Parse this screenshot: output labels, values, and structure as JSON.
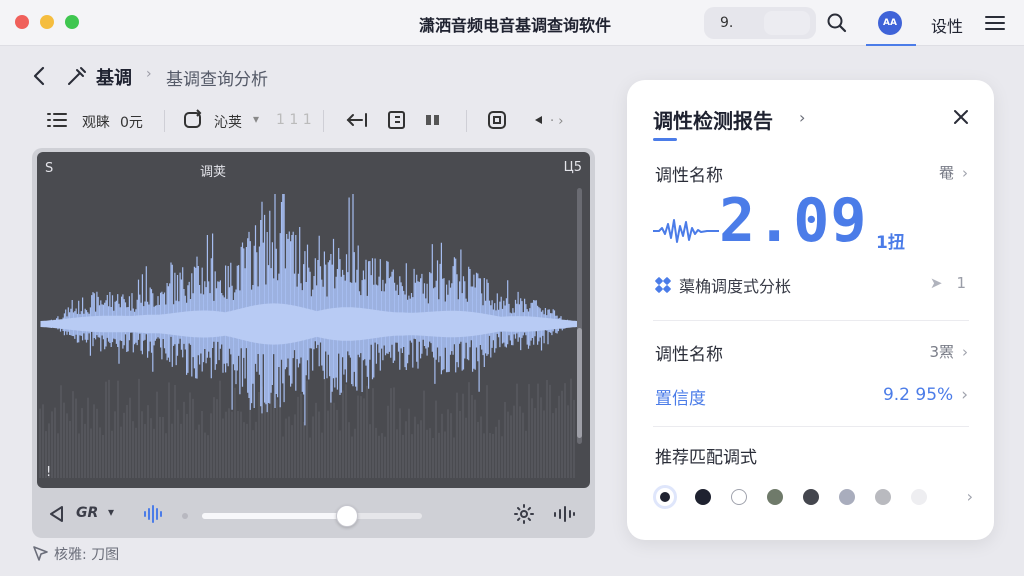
{
  "window": {
    "title": "潇洒音频电音基调查询软件",
    "search_value": "9.",
    "avatar_text": "AA",
    "settings_label": "设性"
  },
  "breadcrumb": {
    "main": "基调",
    "separator": "›",
    "sub": "基调查询分析"
  },
  "toolbar": {
    "list_label": "观睐",
    "count_label": "0元",
    "mode_label": "沁荚",
    "mode_dropdown": "▾",
    "faint_label": "1 1 1"
  },
  "waveform": {
    "corner_left": "S",
    "center_label": "调荚",
    "corner_right": "Ц5",
    "corner_bottom_left": "!",
    "transport_label": "GR",
    "transport_dropdown": "▾",
    "slider_progress": 0.66
  },
  "footnote": "核雅: 刀图",
  "report": {
    "title": "调性检测报告",
    "title_chevron": "›",
    "row1_label": "调性名称",
    "row1_value": "罨",
    "big_value": "2.09",
    "big_unit": "1扭",
    "analysis_text": "蕖桷调度式分枨",
    "analysis_value": "1",
    "row2_label": "调性名称",
    "row2_value": "3罴",
    "confidence_label": "置信度",
    "confidence_value": "9.2 95%",
    "recommend_label": "推荐匹配调式",
    "swatch_colors": [
      "#1f2230",
      "#1f2230",
      "#ffffff",
      "#6f7a6a",
      "#44464e",
      "#a9adbd",
      "#b9babf",
      "#eeeef1"
    ]
  },
  "colors": {
    "accent": "#4b7ce8",
    "wave": "#a6bdf0",
    "panel_bg": "#4a4b50"
  }
}
